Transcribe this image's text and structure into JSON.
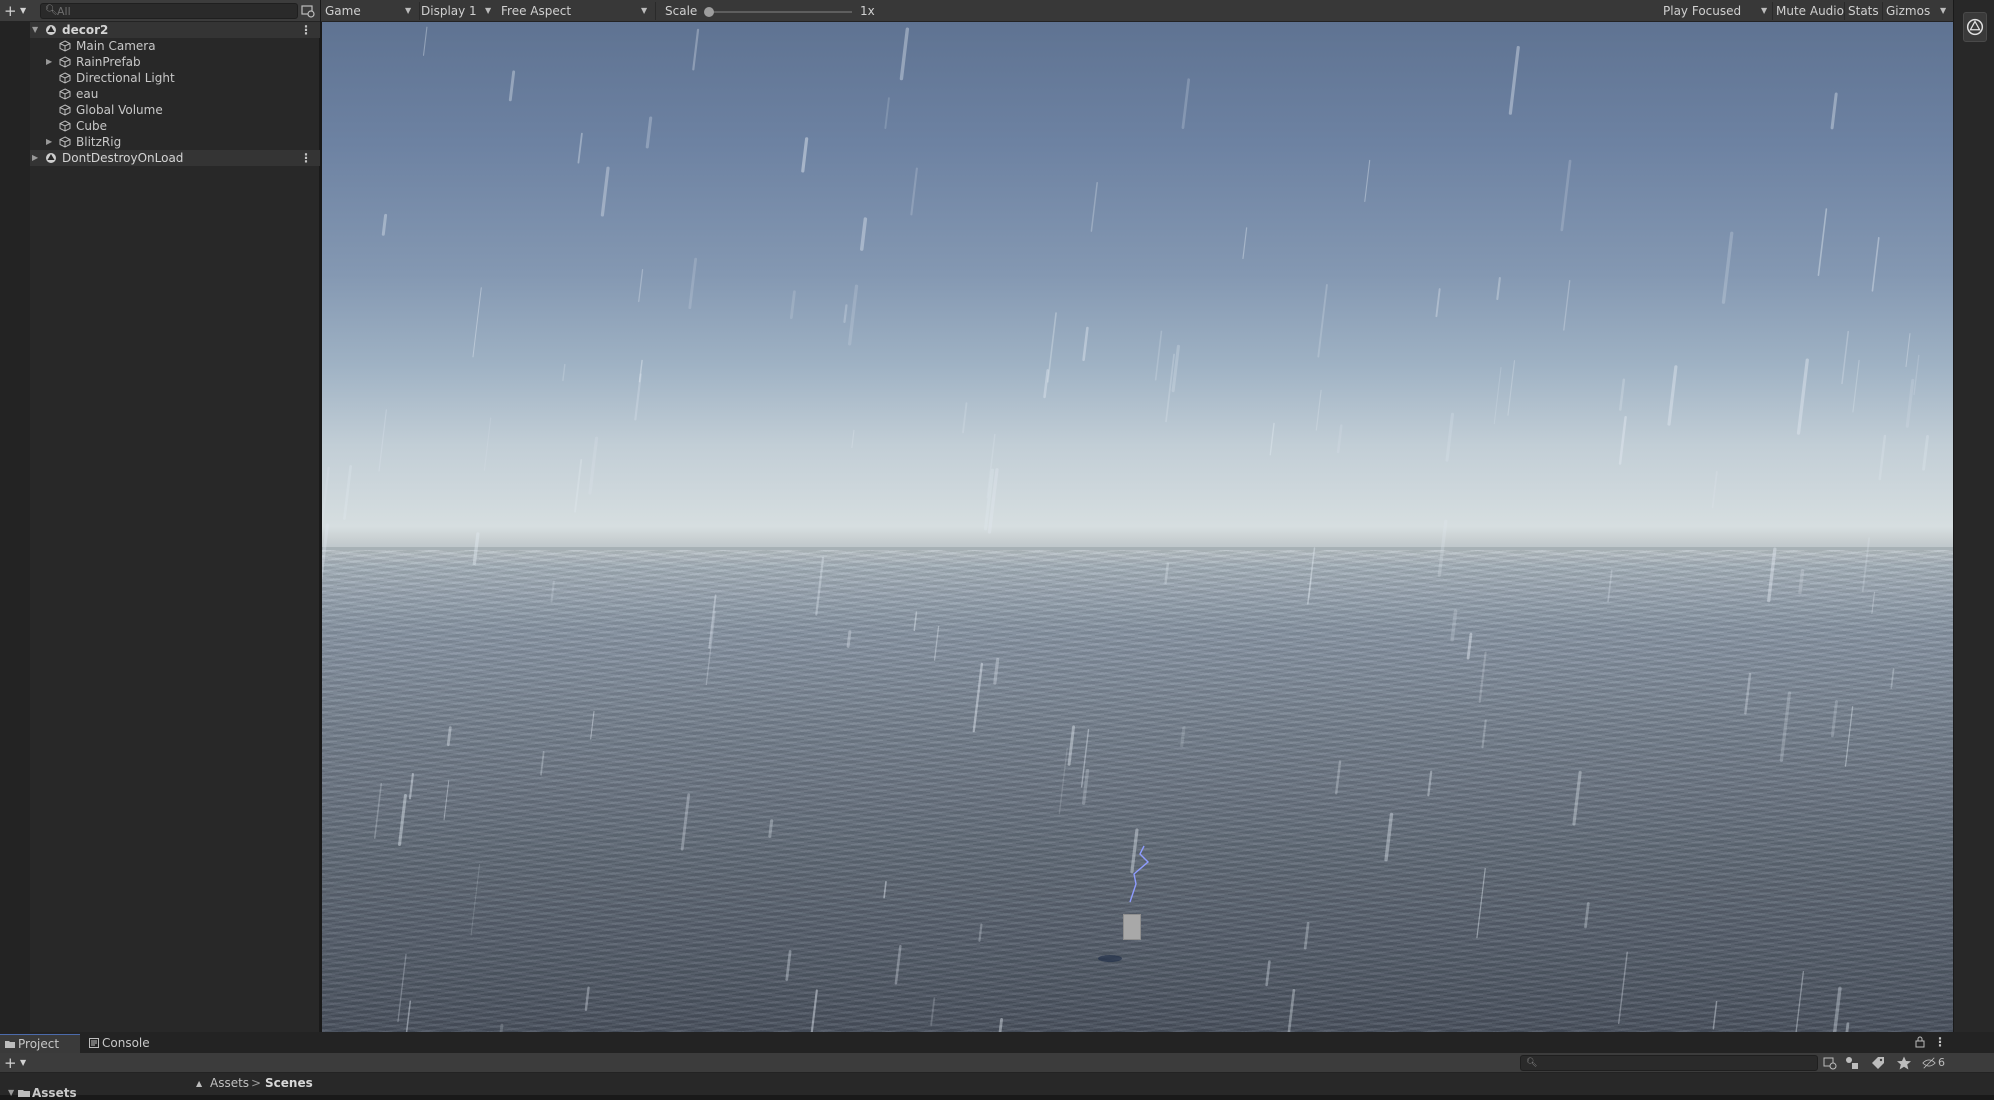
{
  "hierarchy": {
    "search_placeholder": "All",
    "items": [
      {
        "label": "decor2",
        "kind": "scene",
        "expanded": true
      },
      {
        "label": "Main Camera",
        "kind": "object"
      },
      {
        "label": "RainPrefab",
        "kind": "object",
        "has_children": true
      },
      {
        "label": "Directional Light",
        "kind": "object"
      },
      {
        "label": "eau",
        "kind": "object"
      },
      {
        "label": "Global Volume",
        "kind": "object"
      },
      {
        "label": "Cube",
        "kind": "object"
      },
      {
        "label": "BlitzRig",
        "kind": "object",
        "has_children": true
      },
      {
        "label": "DontDestroyOnLoad",
        "kind": "scene",
        "expanded": false
      }
    ]
  },
  "game_toolbar": {
    "view_mode": "Game",
    "display": "Display 1",
    "aspect": "Free Aspect",
    "scale_label": "Scale",
    "scale_value": "1x",
    "scale_fraction": 0.0,
    "play_mode": "Play Focused",
    "mute_audio": "Mute Audio",
    "stats": "Stats",
    "gizmos": "Gizmos"
  },
  "bottom_panel": {
    "tabs": [
      {
        "label": "Project",
        "active": true
      },
      {
        "label": "Console",
        "active": false
      }
    ],
    "breadcrumb": [
      "Assets",
      "Scenes"
    ],
    "breadcrumb_separator": ">",
    "tree_root": "Assets",
    "hidden_count": "6"
  },
  "colors": {
    "panel_bg": "#282828",
    "toolbar_bg": "#383838",
    "selection_accent": "#4c6bab",
    "text": "#c8c8c8"
  }
}
